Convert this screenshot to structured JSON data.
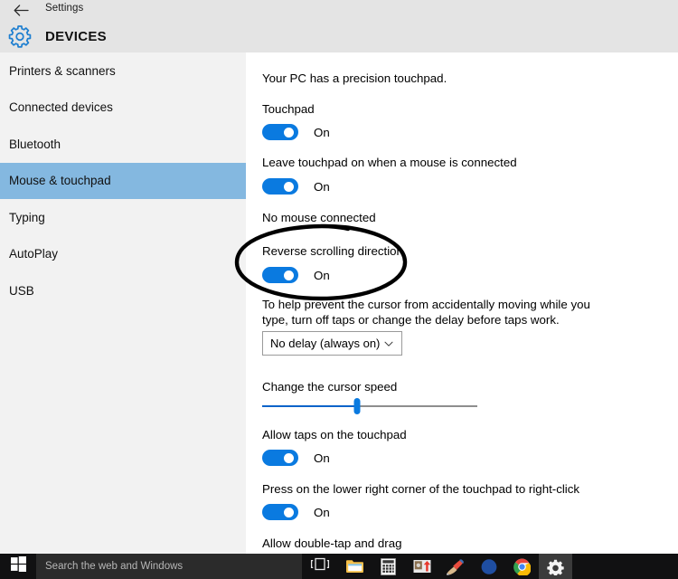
{
  "window": {
    "titlebar_text": "Settings",
    "back_icon": "back-arrow-icon",
    "header_title": "DEVICES",
    "header_icon": "gear-icon"
  },
  "sidebar": {
    "items": [
      {
        "label": "Printers & scanners",
        "selected": false
      },
      {
        "label": "Connected devices",
        "selected": false
      },
      {
        "label": "Bluetooth",
        "selected": false
      },
      {
        "label": "Mouse & touchpad",
        "selected": true
      },
      {
        "label": "Typing",
        "selected": false
      },
      {
        "label": "AutoPlay",
        "selected": false
      },
      {
        "label": "USB",
        "selected": false
      }
    ],
    "selected_bg": "#84b8e0",
    "bg": "#f2f2f2"
  },
  "content": {
    "intro": "Your PC has a precision touchpad.",
    "touchpad": {
      "label": "Touchpad",
      "state": "On"
    },
    "leave_on": {
      "label": "Leave touchpad on when a mouse is connected",
      "state": "On"
    },
    "mouse_status": "No mouse connected",
    "reverse_scroll": {
      "label": "Reverse scrolling direction",
      "state": "On"
    },
    "tap_delay": {
      "help": "To help prevent the cursor from accidentally moving while you type, turn off taps or change the delay before taps work.",
      "selected_option": "No delay (always on)",
      "chevron_icon": "chevron-down-icon"
    },
    "cursor_speed": {
      "label": "Change the cursor speed",
      "value_percent": 44
    },
    "allow_taps": {
      "label": "Allow taps on the touchpad",
      "state": "On"
    },
    "right_click": {
      "label": "Press on the lower right corner of the touchpad to right-click",
      "state": "On"
    },
    "double_tap_drag": {
      "label": "Allow double-tap and drag"
    },
    "toggle_on_color": "#0a7ae0"
  },
  "annotation": {
    "shape": "hand-drawn-ellipse",
    "color": "#000000",
    "encircles": "Reverse scrolling direction"
  },
  "taskbar": {
    "start_icon": "windows-logo-icon",
    "search_placeholder": "Search the web and Windows",
    "taskview_icon": "task-view-icon",
    "bg": "#111112",
    "icons": [
      {
        "name": "file-explorer-icon",
        "active": false
      },
      {
        "name": "calculator-icon",
        "active": false
      },
      {
        "name": "screenshot-tool-icon",
        "active": false
      },
      {
        "name": "ccleaner-icon",
        "active": false
      },
      {
        "name": "malwarebytes-icon",
        "active": false
      },
      {
        "name": "chrome-icon",
        "active": false
      },
      {
        "name": "settings-gear-icon",
        "active": true
      }
    ]
  }
}
